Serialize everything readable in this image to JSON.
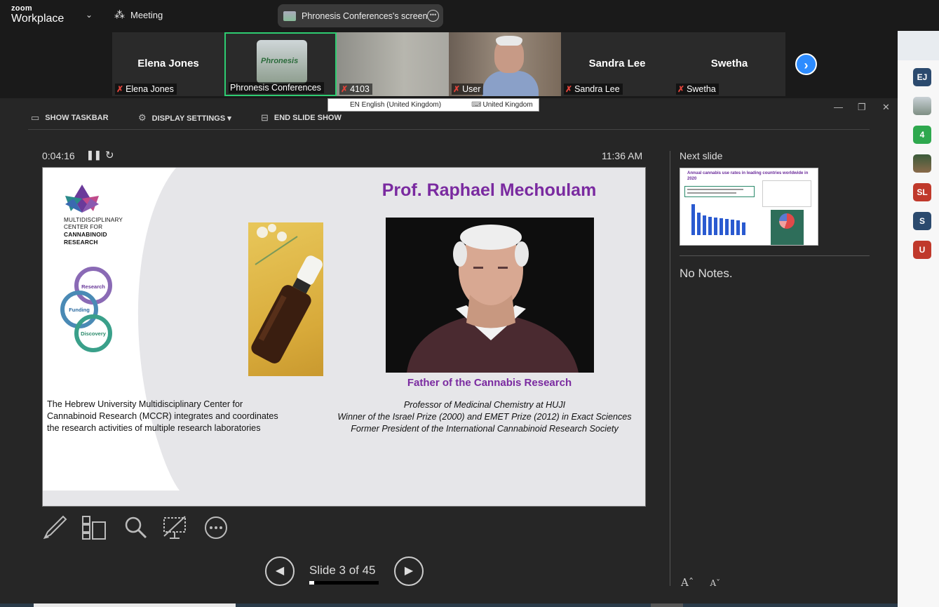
{
  "app": {
    "brand_top": "zoom",
    "brand_bottom": "Workplace",
    "meeting_label": "Meeting",
    "screen_share_label": "Phronesis Conferences's screen"
  },
  "participants": [
    {
      "big_name": "Elena Jones",
      "label": "Elena Jones",
      "muted": true
    },
    {
      "big_name": "",
      "label": "Phronesis Conferences",
      "muted": false,
      "thumb_text": "Phronesis"
    },
    {
      "big_name": "",
      "label": "4103",
      "muted": true
    },
    {
      "big_name": "",
      "label": "User",
      "muted": true
    },
    {
      "big_name": "Sandra Lee",
      "label": "Sandra Lee",
      "muted": true
    },
    {
      "big_name": "Swetha",
      "label": "Swetha",
      "muted": true
    }
  ],
  "language_bar": {
    "input_lang": "EN English (United Kingdom)",
    "keyboard": "United Kingdom"
  },
  "sidebar": {
    "avatars": [
      {
        "initials": "EJ",
        "color": "#2b4a6e"
      },
      {
        "initials": "",
        "color": "#8a9a8a"
      },
      {
        "initials": "4",
        "color": "#2ea84e"
      },
      {
        "initials": "",
        "color": "#5a6a4a"
      },
      {
        "initials": "SL",
        "color": "#c0392b"
      },
      {
        "initials": "S",
        "color": "#2b4a6e"
      },
      {
        "initials": "U",
        "color": "#c0392b"
      }
    ]
  },
  "presenter": {
    "toolbar": {
      "show_taskbar": "SHOW TASKBAR",
      "display_settings": "DISPLAY SETTINGS ▾",
      "end_slide_show": "END SLIDE SHOW"
    },
    "timer": "0:04:16",
    "clock": "11:36 AM",
    "next_slide_label": "Next slide",
    "notes": "No Notes.",
    "slide_counter": "Slide 3 of 45",
    "progress": 0.067,
    "next_slide_title": "Annual cannabis use rates in leading countries worldwide in 2020"
  },
  "slide": {
    "title": "Prof. Raphael  Mechoulam",
    "logo_lines": [
      "MULTIDISCIPLINARY",
      "CENTER FOR",
      "CANNABINOID",
      "RESEARCH"
    ],
    "cycle_labels": [
      "Research",
      "Funding",
      "Discovery"
    ],
    "caption": "Father of the Cannabis Research",
    "left_text": [
      "The Hebrew University Multidisciplinary Center for",
      "Cannabinoid Research (MCCR) integrates and coordinates",
      "the research activities of multiple research laboratories"
    ],
    "bio": [
      "Professor of Medicinal Chemistry at HUJI",
      "Winner of the Israel Prize (2000) and EMET Prize (2012) in Exact Sciences",
      "Former President of the International Cannabinoid Research Society"
    ]
  }
}
